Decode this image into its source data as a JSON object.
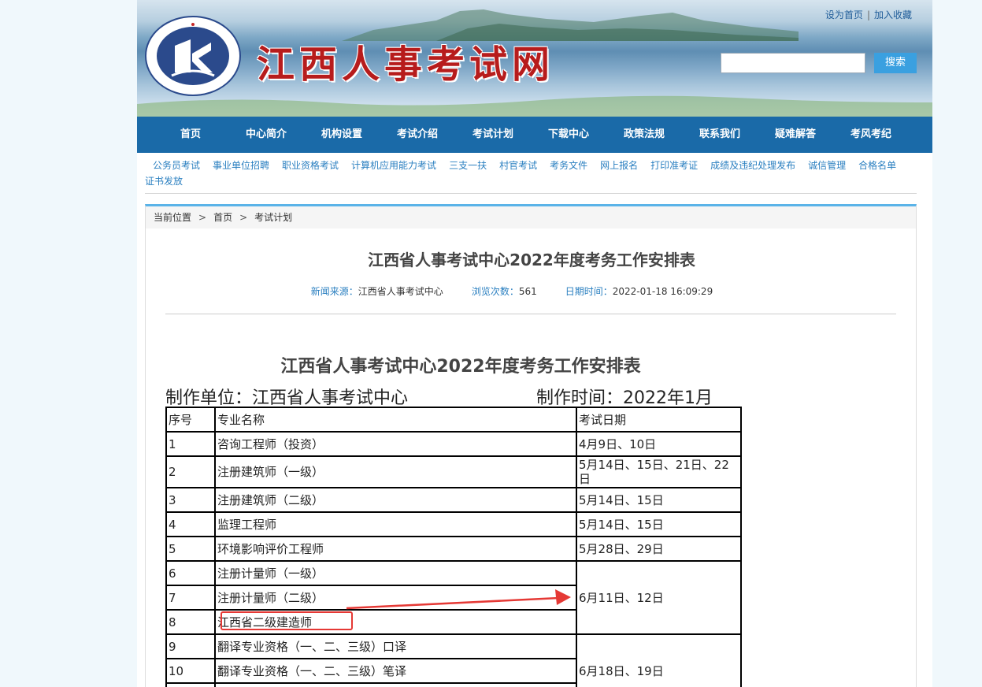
{
  "header": {
    "site_title": "江西人事考试网",
    "logo_label": "Personnel Testing Center of Jiangxi Province",
    "set_home": "设为首页",
    "separator": "|",
    "add_favorite": "加入收藏",
    "search_value": "",
    "search_button": "搜索"
  },
  "nav": [
    "首页",
    "中心简介",
    "机构设置",
    "考试介绍",
    "考试计划",
    "下载中心",
    "政策法规",
    "联系我们",
    "疑难解答",
    "考风考纪"
  ],
  "sub_links": [
    "公务员考试",
    "事业单位招聘",
    "职业资格考试",
    "计算机应用能力考试",
    "三支一扶",
    "村官考试",
    "考务文件",
    "网上报名",
    "打印准考证",
    "成绩及违纪处理发布",
    "诚信管理",
    "合格名单",
    "证书发放"
  ],
  "breadcrumb": {
    "label": "当前位置",
    "arrow": ">",
    "items": [
      "首页",
      "考试计划"
    ]
  },
  "article": {
    "title": "江西省人事考试中心2022年度考务工作安排表",
    "source_label": "新闻来源：",
    "source_value": "江西省人事考试中心",
    "views_label": "浏览次数：",
    "views_value": "561",
    "date_label": "日期时间：",
    "date_value": "2022-01-18 16:09:29"
  },
  "doc": {
    "title": "江西省人事考试中心2022年度考务工作安排表",
    "maker": "制作单位：江西省人事考试中心",
    "made_time": "制作时间：2022年1月"
  },
  "table": {
    "headers": [
      "序号",
      "专业名称",
      "考试日期"
    ],
    "rows": [
      {
        "no": "1",
        "name": "咨询工程师（投资）",
        "date": "4月9日、10日"
      },
      {
        "no": "2",
        "name": "注册建筑师（一级）",
        "date": "5月14日、15日、21日、22日"
      },
      {
        "no": "3",
        "name": "注册建筑师（二级）",
        "date": "5月14日、15日"
      },
      {
        "no": "4",
        "name": "监理工程师",
        "date": "5月14日、15日"
      },
      {
        "no": "5",
        "name": "环境影响评价工程师",
        "date": "5月28日、29日"
      },
      {
        "no": "6",
        "name": "注册计量师（一级）",
        "date": "6月11日、12日"
      },
      {
        "no": "7",
        "name": "注册计量师（二级）",
        "date": ""
      },
      {
        "no": "8",
        "name": "江西省二级建造师",
        "date": ""
      },
      {
        "no": "9",
        "name": "翻译专业资格（一、二、三级）口译",
        "date": "6月18日、19日"
      },
      {
        "no": "10",
        "name": "翻译专业资格（一、二、三级）笔译",
        "date": ""
      }
    ]
  },
  "colors": {
    "nav_bg": "#1a6aa8",
    "accent": "#5ab3e8",
    "annotation": "#e53935",
    "title_red": "#b71c1c"
  }
}
